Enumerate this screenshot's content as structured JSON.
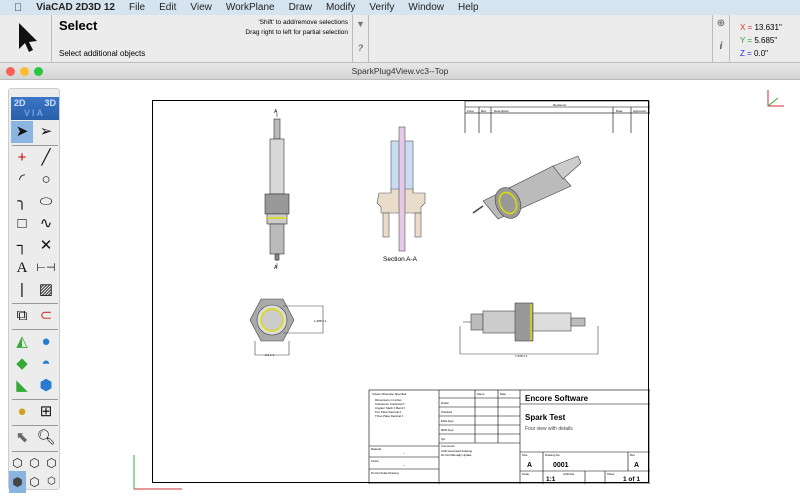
{
  "menubar": {
    "apple": "",
    "app": "ViaCAD 2D3D 12",
    "items": [
      "File",
      "Edit",
      "View",
      "WorkPlane",
      "Draw",
      "Modify",
      "Verify",
      "Window",
      "Help"
    ]
  },
  "prompt": {
    "title": "Select",
    "hint1": "'Shift' to add/remove selections",
    "hint2": "Drag right to left for partial selection",
    "subtitle": "Select additional objects",
    "help": "?"
  },
  "coords": {
    "x_label": "X =",
    "x": "13.631\"",
    "y_label": "Y =",
    "y": "5.685\"",
    "z_label": "Z =",
    "z": "0.0\"",
    "x_color": "#e03030",
    "y_color": "#30a030",
    "z_color": "#3030d0"
  },
  "window": {
    "title": "SparkPlug4View.vc3--Top"
  },
  "palette": {
    "logo_2d": "2D",
    "logo_3d": "3D",
    "logo_via": "VIA"
  },
  "drawing": {
    "revisions": {
      "title": "Revisions",
      "cols": [
        "Zone",
        "Rev",
        "Description",
        "Date",
        "Approved"
      ]
    },
    "section_label": "Section A-A",
    "section_mark": "A",
    "dim1": "1.288 ±.1",
    "dim2": "2.2 ±.1",
    "dim3": "7.038 ±.1",
    "titleblock": {
      "tolerances": [
        "Unless Otherwise Specified:",
        "Dimensions in Inches",
        "Tolerances: Fractional ±",
        "Angular: Mach ±  Bend ±",
        "Two Place Decimal  ±",
        "Three Place Decimal  ±"
      ],
      "name": "Name",
      "date": "Date",
      "rows": [
        "Drawn",
        "Checked",
        "ENG Appr.",
        "MFR Appr.",
        "QA"
      ],
      "comments": "Comments",
      "comment_lines": [
        "CAD Generated Drawing",
        "Do Not Manually Update"
      ],
      "material": "Material",
      "finish": "Finish",
      "dash": "--",
      "noscale": "Do Not Scale Drawing",
      "company": "Encore Software",
      "title": "Spark Test",
      "description": "Four view with details",
      "size_label": "Size",
      "size": "A",
      "dwg_label": "Drawing No.",
      "dwg": "0001",
      "rev_label": "Rev",
      "rev": "A",
      "scale_label": "Scale",
      "scale": "1:1",
      "cad_label": "CAD File",
      "sheet_label": "Sheet",
      "sheet": "1 of 1"
    }
  }
}
